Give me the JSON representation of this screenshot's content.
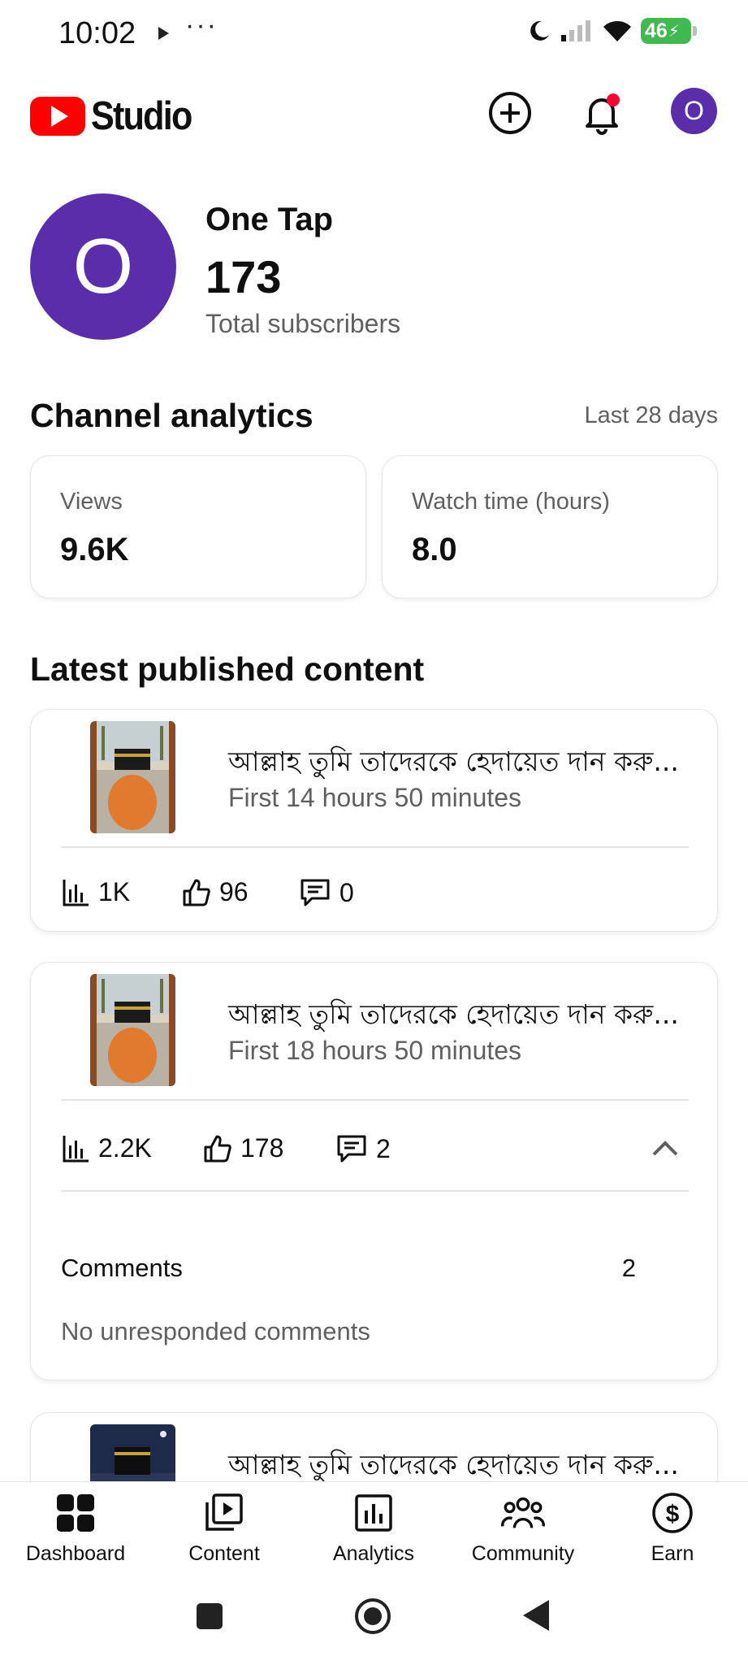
{
  "status_bar": {
    "time": "10:02",
    "dots": "···",
    "battery": "46"
  },
  "header": {
    "logo_text": "Studio",
    "avatar_letter": "O"
  },
  "channel": {
    "avatar_letter": "O",
    "name": "One Tap",
    "subscribers": "173",
    "subscribers_label": "Total subscribers"
  },
  "analytics": {
    "title": "Channel analytics",
    "period": "Last 28 days",
    "cards": [
      {
        "label": "Views",
        "value": "9.6K"
      },
      {
        "label": "Watch time (hours)",
        "value": "8.0"
      }
    ]
  },
  "latest": {
    "title": "Latest published content",
    "items": [
      {
        "title": "আল্লাহ তুমি তাদেরকে হেদায়েত দান করু...",
        "age": "First 14 hours 50 minutes",
        "views": "1K",
        "likes": "96",
        "comments": "0"
      },
      {
        "title": "আল্লাহ তুমি তাদেরকে হেদায়েত দান করু...",
        "age": "First 18 hours 50 minutes",
        "views": "2.2K",
        "likes": "178",
        "comments": "2",
        "expanded": {
          "comments_label": "Comments",
          "comments_count": "2",
          "unresponded": "No unresponded comments"
        }
      },
      {
        "title": "আল্লাহ তুমি তাদেরকে হেদায়েত দান করু..."
      }
    ]
  },
  "bottom_nav": [
    {
      "label": "Dashboard",
      "icon": "dashboard-icon"
    },
    {
      "label": "Content",
      "icon": "content-icon"
    },
    {
      "label": "Analytics",
      "icon": "analytics-icon"
    },
    {
      "label": "Community",
      "icon": "community-icon"
    },
    {
      "label": "Earn",
      "icon": "earn-icon"
    }
  ],
  "colors": {
    "brand_red": "#ff0000",
    "avatar_purple": "#5a2eab",
    "notification_dot": "#ff0033",
    "secondary_text": "#606060"
  }
}
